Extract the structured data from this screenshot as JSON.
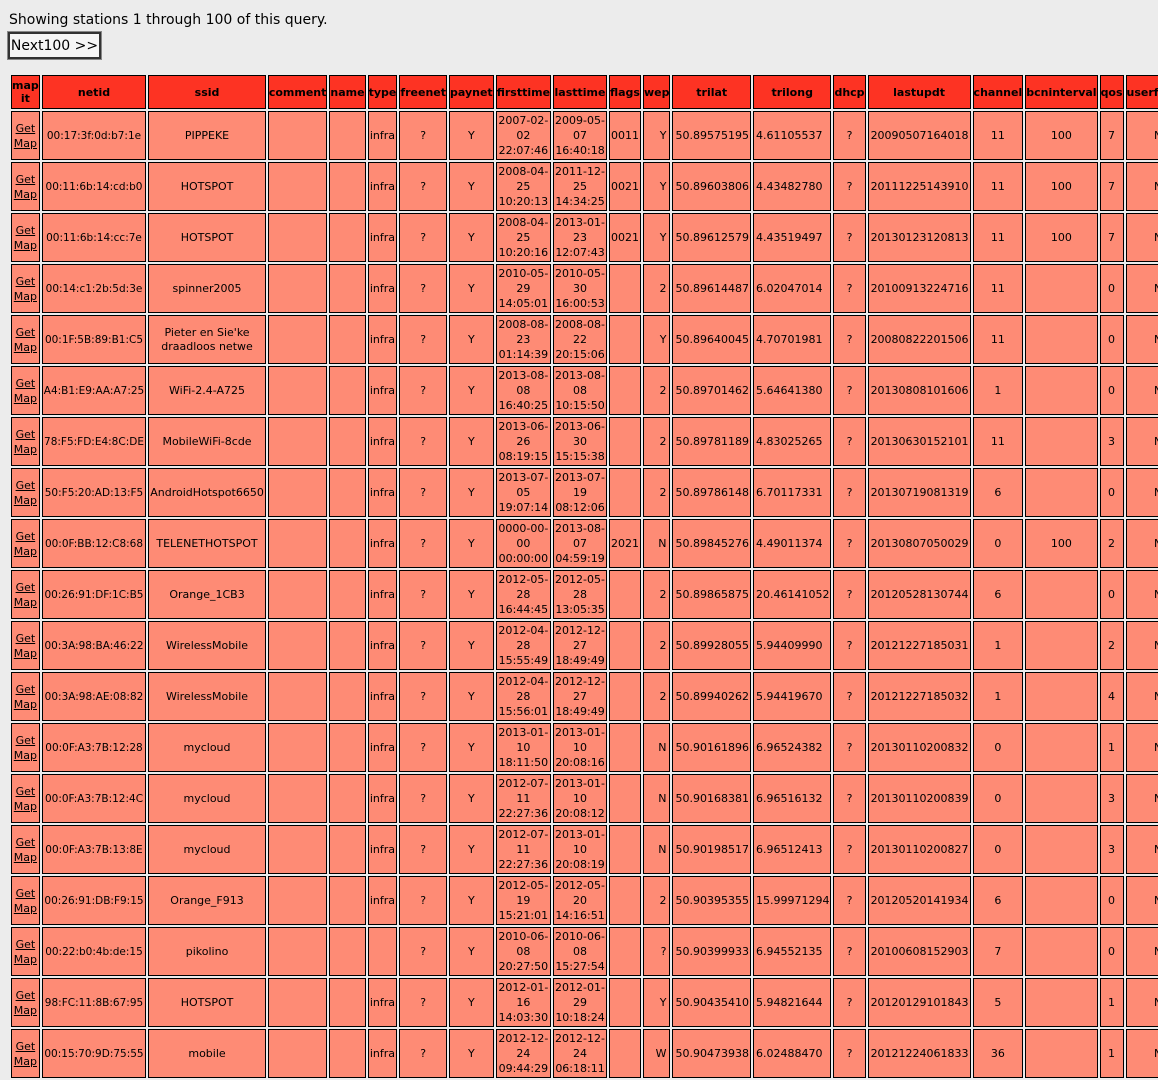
{
  "status_text": "Showing stations 1 through 100 of this query.",
  "next_button": "Next100 >>",
  "link_label": "Get Map",
  "headers": [
    "map it",
    "netid",
    "ssid",
    "comment",
    "name",
    "type",
    "freenet",
    "paynet",
    "firsttime",
    "lasttime",
    "flags",
    "wep",
    "trilat",
    "trilong",
    "dhcp",
    "lastupdt",
    "channel",
    "bcninterval",
    "qos",
    "userfound"
  ],
  "rows": [
    {
      "netid": "00:17:3f:0d:b7:1e",
      "ssid": "PIPPEKE",
      "comment": "",
      "name": "",
      "type": "infra",
      "freenet": "?",
      "paynet": "Y",
      "firsttime": "2007-02-\n02\n22:07:46",
      "lasttime": "2009-05-\n07\n16:40:18",
      "flags": "0011",
      "wep": "Y",
      "trilat": "50.89575195",
      "trilong": "4.61105537",
      "dhcp": "?",
      "lastupdt": "20090507164018",
      "channel": "11",
      "bcninterval": "100",
      "qos": "7",
      "userfound": "N"
    },
    {
      "netid": "00:11:6b:14:cd:b0",
      "ssid": "HOTSPOT",
      "comment": "",
      "name": "",
      "type": "infra",
      "freenet": "?",
      "paynet": "Y",
      "firsttime": "2008-04-\n25\n10:20:13",
      "lasttime": "2011-12-\n25\n14:34:25",
      "flags": "0021",
      "wep": "Y",
      "trilat": "50.89603806",
      "trilong": "4.43482780",
      "dhcp": "?",
      "lastupdt": "20111225143910",
      "channel": "11",
      "bcninterval": "100",
      "qos": "7",
      "userfound": "N"
    },
    {
      "netid": "00:11:6b:14:cc:7e",
      "ssid": "HOTSPOT",
      "comment": "",
      "name": "",
      "type": "infra",
      "freenet": "?",
      "paynet": "Y",
      "firsttime": "2008-04-\n25\n10:20:16",
      "lasttime": "2013-01-\n23\n12:07:43",
      "flags": "0021",
      "wep": "Y",
      "trilat": "50.89612579",
      "trilong": "4.43519497",
      "dhcp": "?",
      "lastupdt": "20130123120813",
      "channel": "11",
      "bcninterval": "100",
      "qos": "7",
      "userfound": "N"
    },
    {
      "netid": "00:14:c1:2b:5d:3e",
      "ssid": "spinner2005",
      "comment": "",
      "name": "",
      "type": "infra",
      "freenet": "?",
      "paynet": "Y",
      "firsttime": "2010-05-\n29\n14:05:01",
      "lasttime": "2010-05-\n30\n16:00:53",
      "flags": "",
      "wep": "2",
      "trilat": "50.89614487",
      "trilong": "6.02047014",
      "dhcp": "?",
      "lastupdt": "20100913224716",
      "channel": "11",
      "bcninterval": "",
      "qos": "0",
      "userfound": "N"
    },
    {
      "netid": "00:1F:5B:89:B1:C5",
      "ssid": "Pieter en Sie'ke draadloos netwe",
      "comment": "",
      "name": "",
      "type": "infra",
      "freenet": "?",
      "paynet": "Y",
      "firsttime": "2008-08-\n23\n01:14:39",
      "lasttime": "2008-08-\n22\n20:15:06",
      "flags": "",
      "wep": "Y",
      "trilat": "50.89640045",
      "trilong": "4.70701981",
      "dhcp": "?",
      "lastupdt": "20080822201506",
      "channel": "11",
      "bcninterval": "",
      "qos": "0",
      "userfound": "N"
    },
    {
      "netid": "A4:B1:E9:AA:A7:25",
      "ssid": "WiFi-2.4-A725",
      "comment": "",
      "name": "",
      "type": "infra",
      "freenet": "?",
      "paynet": "Y",
      "firsttime": "2013-08-\n08\n16:40:25",
      "lasttime": "2013-08-\n08\n10:15:50",
      "flags": "",
      "wep": "2",
      "trilat": "50.89701462",
      "trilong": "5.64641380",
      "dhcp": "?",
      "lastupdt": "20130808101606",
      "channel": "1",
      "bcninterval": "",
      "qos": "0",
      "userfound": "N"
    },
    {
      "netid": "78:F5:FD:E4:8C:DE",
      "ssid": "MobileWiFi-8cde",
      "comment": "",
      "name": "",
      "type": "infra",
      "freenet": "?",
      "paynet": "Y",
      "firsttime": "2013-06-\n26\n08:19:15",
      "lasttime": "2013-06-\n30\n15:15:38",
      "flags": "",
      "wep": "2",
      "trilat": "50.89781189",
      "trilong": "4.83025265",
      "dhcp": "?",
      "lastupdt": "20130630152101",
      "channel": "11",
      "bcninterval": "",
      "qos": "3",
      "userfound": "N"
    },
    {
      "netid": "50:F5:20:AD:13:F5",
      "ssid": "AndroidHotspot6650",
      "comment": "",
      "name": "",
      "type": "infra",
      "freenet": "?",
      "paynet": "Y",
      "firsttime": "2013-07-\n05\n19:07:14",
      "lasttime": "2013-07-\n19\n08:12:06",
      "flags": "",
      "wep": "2",
      "trilat": "50.89786148",
      "trilong": "6.70117331",
      "dhcp": "?",
      "lastupdt": "20130719081319",
      "channel": "6",
      "bcninterval": "",
      "qos": "0",
      "userfound": "N"
    },
    {
      "netid": "00:0F:BB:12:C8:68",
      "ssid": "TELENETHOTSPOT",
      "comment": "",
      "name": "",
      "type": "infra",
      "freenet": "?",
      "paynet": "Y",
      "firsttime": "0000-00-\n00\n00:00:00",
      "lasttime": "2013-08-\n07\n04:59:19",
      "flags": "2021",
      "wep": "N",
      "trilat": "50.89845276",
      "trilong": "4.49011374",
      "dhcp": "?",
      "lastupdt": "20130807050029",
      "channel": "0",
      "bcninterval": "100",
      "qos": "2",
      "userfound": "N"
    },
    {
      "netid": "00:26:91:DF:1C:B5",
      "ssid": "Orange_1CB3",
      "comment": "",
      "name": "",
      "type": "infra",
      "freenet": "?",
      "paynet": "Y",
      "firsttime": "2012-05-\n28\n16:44:45",
      "lasttime": "2012-05-\n28\n13:05:35",
      "flags": "",
      "wep": "2",
      "trilat": "50.89865875",
      "trilong": "20.46141052",
      "dhcp": "?",
      "lastupdt": "20120528130744",
      "channel": "6",
      "bcninterval": "",
      "qos": "0",
      "userfound": "N"
    },
    {
      "netid": "00:3A:98:BA:46:22",
      "ssid": "WirelessMobile",
      "comment": "",
      "name": "",
      "type": "infra",
      "freenet": "?",
      "paynet": "Y",
      "firsttime": "2012-04-\n28\n15:55:49",
      "lasttime": "2012-12-\n27\n18:49:49",
      "flags": "",
      "wep": "2",
      "trilat": "50.89928055",
      "trilong": "5.94409990",
      "dhcp": "?",
      "lastupdt": "20121227185031",
      "channel": "1",
      "bcninterval": "",
      "qos": "2",
      "userfound": "N"
    },
    {
      "netid": "00:3A:98:AE:08:82",
      "ssid": "WirelessMobile",
      "comment": "",
      "name": "",
      "type": "infra",
      "freenet": "?",
      "paynet": "Y",
      "firsttime": "2012-04-\n28\n15:56:01",
      "lasttime": "2012-12-\n27\n18:49:49",
      "flags": "",
      "wep": "2",
      "trilat": "50.89940262",
      "trilong": "5.94419670",
      "dhcp": "?",
      "lastupdt": "20121227185032",
      "channel": "1",
      "bcninterval": "",
      "qos": "4",
      "userfound": "N"
    },
    {
      "netid": "00:0F:A3:7B:12:28",
      "ssid": "mycloud",
      "comment": "",
      "name": "",
      "type": "infra",
      "freenet": "?",
      "paynet": "Y",
      "firsttime": "2013-01-\n10\n18:11:50",
      "lasttime": "2013-01-\n10\n20:08:16",
      "flags": "",
      "wep": "N",
      "trilat": "50.90161896",
      "trilong": "6.96524382",
      "dhcp": "?",
      "lastupdt": "20130110200832",
      "channel": "0",
      "bcninterval": "",
      "qos": "1",
      "userfound": "N"
    },
    {
      "netid": "00:0F:A3:7B:12:4C",
      "ssid": "mycloud",
      "comment": "",
      "name": "",
      "type": "infra",
      "freenet": "?",
      "paynet": "Y",
      "firsttime": "2012-07-\n11\n22:27:36",
      "lasttime": "2013-01-\n10\n20:08:12",
      "flags": "",
      "wep": "N",
      "trilat": "50.90168381",
      "trilong": "6.96516132",
      "dhcp": "?",
      "lastupdt": "20130110200839",
      "channel": "0",
      "bcninterval": "",
      "qos": "3",
      "userfound": "N"
    },
    {
      "netid": "00:0F:A3:7B:13:8E",
      "ssid": "mycloud",
      "comment": "",
      "name": "",
      "type": "infra",
      "freenet": "?",
      "paynet": "Y",
      "firsttime": "2012-07-\n11\n22:27:36",
      "lasttime": "2013-01-\n10\n20:08:19",
      "flags": "",
      "wep": "N",
      "trilat": "50.90198517",
      "trilong": "6.96512413",
      "dhcp": "?",
      "lastupdt": "20130110200827",
      "channel": "0",
      "bcninterval": "",
      "qos": "3",
      "userfound": "N"
    },
    {
      "netid": "00:26:91:DB:F9:15",
      "ssid": "Orange_F913",
      "comment": "",
      "name": "",
      "type": "infra",
      "freenet": "?",
      "paynet": "Y",
      "firsttime": "2012-05-\n19\n15:21:01",
      "lasttime": "2012-05-\n20\n14:16:51",
      "flags": "",
      "wep": "2",
      "trilat": "50.90395355",
      "trilong": "15.99971294",
      "dhcp": "?",
      "lastupdt": "20120520141934",
      "channel": "6",
      "bcninterval": "",
      "qos": "0",
      "userfound": "N"
    },
    {
      "netid": "00:22:b0:4b:de:15",
      "ssid": "pikolino",
      "comment": "",
      "name": "",
      "type": "",
      "freenet": "?",
      "paynet": "Y",
      "firsttime": "2010-06-\n08\n20:27:50",
      "lasttime": "2010-06-\n08\n15:27:54",
      "flags": "",
      "wep": "?",
      "trilat": "50.90399933",
      "trilong": "6.94552135",
      "dhcp": "?",
      "lastupdt": "20100608152903",
      "channel": "7",
      "bcninterval": "",
      "qos": "0",
      "userfound": "N"
    },
    {
      "netid": "98:FC:11:8B:67:95",
      "ssid": "HOTSPOT",
      "comment": "",
      "name": "",
      "type": "infra",
      "freenet": "?",
      "paynet": "Y",
      "firsttime": "2012-01-\n16\n14:03:30",
      "lasttime": "2012-01-\n29\n10:18:24",
      "flags": "",
      "wep": "Y",
      "trilat": "50.90435410",
      "trilong": "5.94821644",
      "dhcp": "?",
      "lastupdt": "20120129101843",
      "channel": "5",
      "bcninterval": "",
      "qos": "1",
      "userfound": "N"
    },
    {
      "netid": "00:15:70:9D:75:55",
      "ssid": "mobile",
      "comment": "",
      "name": "",
      "type": "infra",
      "freenet": "?",
      "paynet": "Y",
      "firsttime": "2012-12-\n24\n09:44:29",
      "lasttime": "2012-12-\n24\n06:18:11",
      "flags": "",
      "wep": "W",
      "trilat": "50.90473938",
      "trilong": "6.02488470",
      "dhcp": "?",
      "lastupdt": "20121224061833",
      "channel": "36",
      "bcninterval": "",
      "qos": "1",
      "userfound": "N"
    }
  ]
}
